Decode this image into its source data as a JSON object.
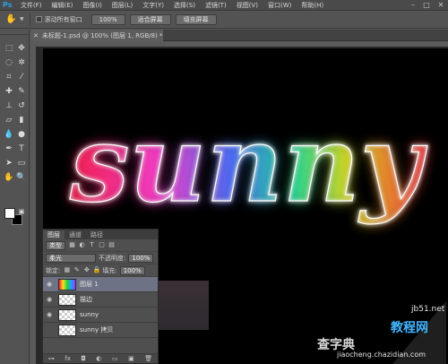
{
  "menubar": {
    "logo": "Ps",
    "items": [
      "文件(F)",
      "编辑(E)",
      "图像(I)",
      "图层(L)",
      "文字(Y)",
      "选择(S)",
      "滤镜(T)",
      "视图(V)",
      "窗口(W)",
      "帮助(H)"
    ],
    "window_controls": [
      "–",
      "□",
      "✕"
    ]
  },
  "options": {
    "tool_icon": "hand-icon",
    "scroll_all_label": "滚动所有窗口",
    "zoom_100_label": "100%",
    "fit_screen_label": "适合屏幕",
    "fill_screen_label": "填充屏幕"
  },
  "document": {
    "tab_title": "未标题-1.psd @ 100% (图层 1, RGB/8) *",
    "text": "sunny"
  },
  "layers_panel": {
    "tabs": [
      "图层",
      "通道",
      "路径"
    ],
    "filter_kind": "类型",
    "blend_mode": "柔光",
    "opacity_label": "不透明度:",
    "opacity_value": "100%",
    "lock_label": "锁定:",
    "fill_label": "填充:",
    "fill_value": "100%",
    "layers": [
      {
        "name": "图层 1",
        "visible": true,
        "selected": true,
        "thumb": "rainbow"
      },
      {
        "name": "描边",
        "visible": true,
        "selected": false,
        "thumb": "transparent"
      },
      {
        "name": "sunny",
        "visible": true,
        "selected": false,
        "thumb": "transparent"
      },
      {
        "name": "sunny 拷贝",
        "visible": false,
        "selected": false,
        "thumb": "transparent"
      }
    ]
  },
  "watermark": {
    "line1": "jb51.net",
    "line2": "教程网",
    "line3": "查字典",
    "line4": "jiaocheng.chazidian.com"
  },
  "colors": {
    "accent": "#2d9fe8",
    "selected_layer": "#6d7384",
    "foreground": "#ffffff",
    "background": "#000000"
  }
}
